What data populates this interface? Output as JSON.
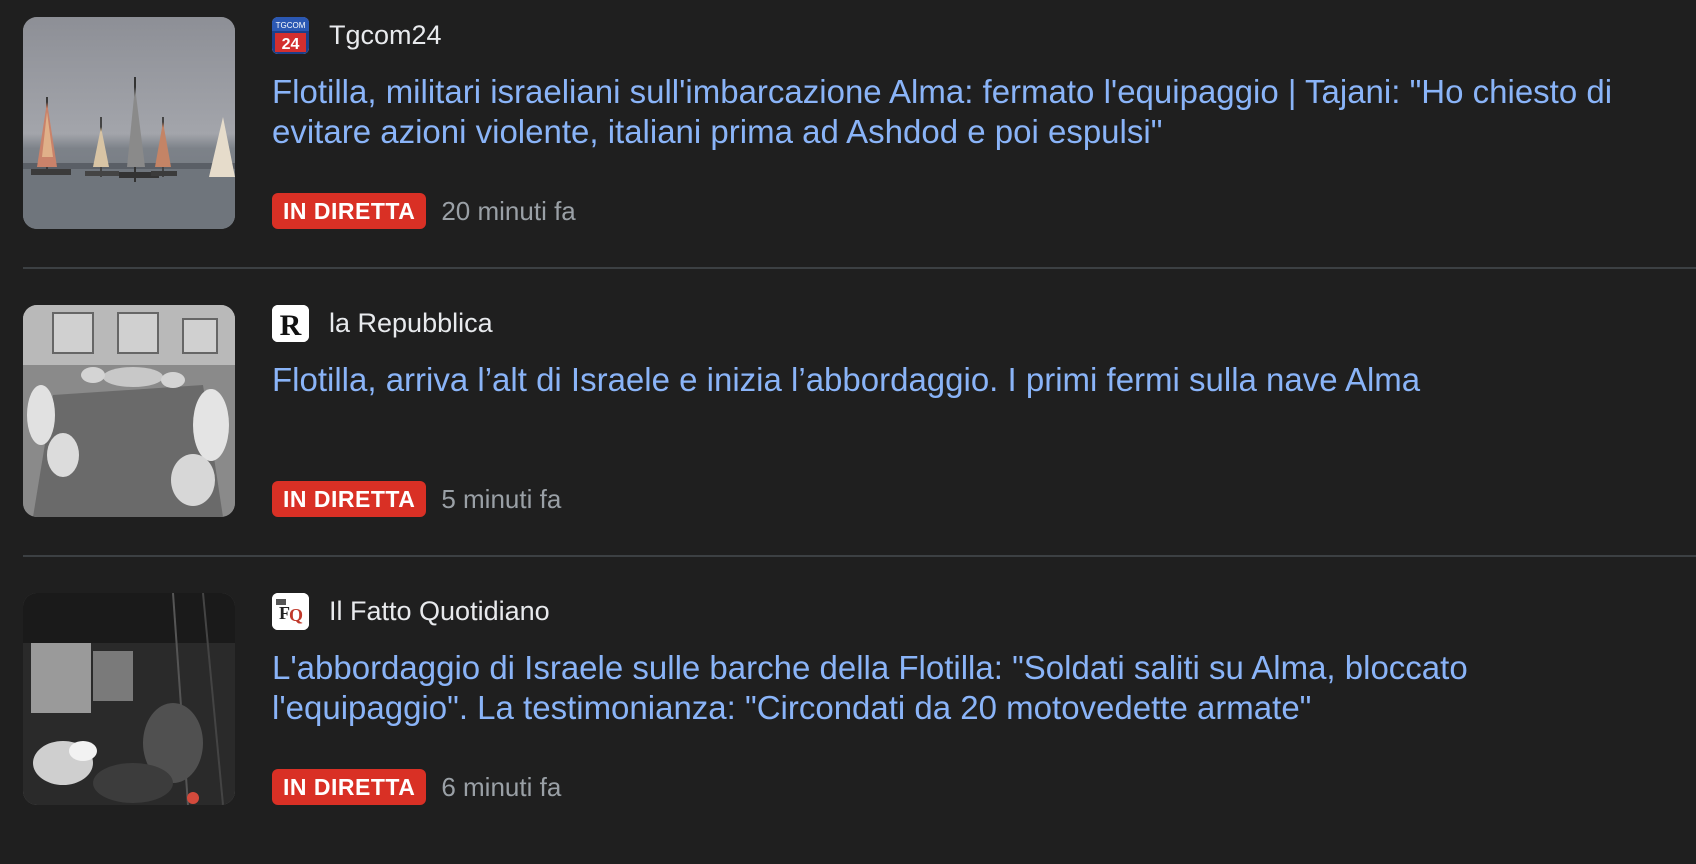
{
  "articles": [
    {
      "source": "Tgcom24",
      "source_logo": "tgcom24-logo",
      "headline": "Flotilla, militari israeliani sull'imbarcazione Alma: fermato l'equipaggio | Tajani: \"Ho chiesto di evitare azioni violente, italiani prima ad Ashdod e poi espulsi\"",
      "badge": "IN DIRETTA",
      "time": "20 minuti fa",
      "thumbnail": "sailboats-photo"
    },
    {
      "source": "la Repubblica",
      "source_logo": "repubblica-logo",
      "headline": "Flotilla, arriva l’alt di Israele e inizia l’abbordaggio. I primi fermi sulla nave Alma",
      "badge": "IN DIRETTA",
      "time": "5 minuti fa",
      "thumbnail": "deck-crew-photo"
    },
    {
      "source": "Il Fatto Quotidiano",
      "source_logo": "fatto-quotidiano-logo",
      "headline": "L'abbordaggio di Israele sulle barche della Flotilla: \"Soldati saliti su Alma, bloccato l'equipaggio\". La testimonianza: \"Circondati da 20 motovedette armate\"",
      "badge": "IN DIRETTA",
      "time": "6 minuti fa",
      "thumbnail": "night-deck-photo"
    }
  ],
  "colors": {
    "background": "#1f1f1f",
    "headline": "#8ab4f8",
    "live_badge": "#d93025",
    "timestamp": "#9aa0a6",
    "divider": "#3c4043"
  }
}
